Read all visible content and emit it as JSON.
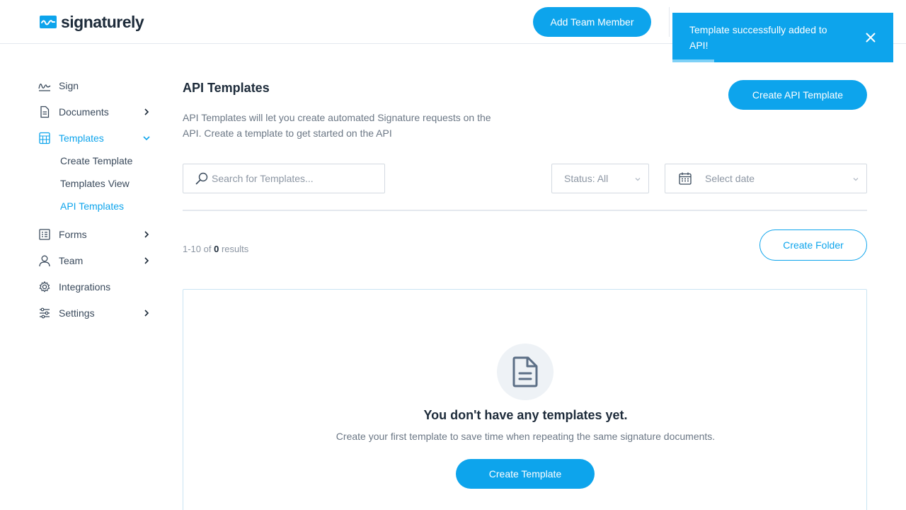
{
  "brand": {
    "name": "signaturely",
    "accent": "#0da4ec",
    "icon": "signaturely-logo-icon"
  },
  "header": {
    "add_team_member": "Add Team Member"
  },
  "toast": {
    "message": "Template successfully added to API!",
    "close_icon": "close-icon",
    "progress": 0.19
  },
  "sidebar": {
    "items": [
      {
        "label": "Sign",
        "icon": "signature-icon"
      },
      {
        "label": "Documents",
        "icon": "document-icon"
      },
      {
        "label": "Templates",
        "icon": "template-icon"
      },
      {
        "label": "Forms",
        "icon": "forms-icon"
      },
      {
        "label": "Team",
        "icon": "user-icon"
      },
      {
        "label": "Integrations",
        "icon": "gear-icon"
      },
      {
        "label": "Settings",
        "icon": "sliders-icon"
      }
    ],
    "templates_sub": [
      {
        "label": "Create Template"
      },
      {
        "label": "Templates View"
      },
      {
        "label": "API Templates"
      }
    ]
  },
  "main": {
    "title": "API Templates",
    "description": "API Templates will let you create automated Signature requests on the API. Create a template to get started on the API",
    "create_api_template": "Create API Template",
    "search_placeholder": "Search for Templates...",
    "status_filter": "Status: All",
    "date_placeholder": "Select date",
    "results": {
      "prefix": "1-10 of",
      "count": "0",
      "suffix": "results"
    },
    "create_folder": "Create Folder",
    "empty": {
      "title": "You don't have any templates yet.",
      "description": "Create your first template to save time when repeating the same signature documents.",
      "button": "Create Template",
      "icon": "document-icon"
    }
  }
}
